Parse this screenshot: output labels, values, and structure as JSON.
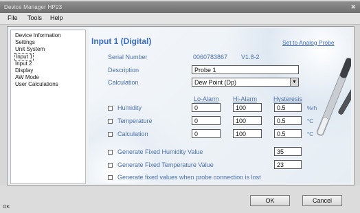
{
  "window": {
    "title": "Device Manager HP23",
    "close_glyph": "✕"
  },
  "menu": [
    "File",
    "Tools",
    "Help"
  ],
  "tree": [
    {
      "label": "Device Information",
      "selected": false
    },
    {
      "label": "Settings",
      "selected": false
    },
    {
      "label": "Unit System",
      "selected": false
    },
    {
      "label": "Input 1",
      "selected": true
    },
    {
      "label": "Input 2",
      "selected": false
    },
    {
      "label": "Display",
      "selected": false
    },
    {
      "label": "AW Mode",
      "selected": false
    },
    {
      "label": "User Calculations",
      "selected": false
    }
  ],
  "panel": {
    "heading": "Input 1 (Digital)",
    "link": "Set to Analog Probe",
    "serial_label": "Serial Number",
    "serial_value": "0060783867",
    "version": "V1.8-2",
    "description_label": "Description",
    "description_value": "Probe 1",
    "calculation_label": "Calculation",
    "calculation_value": "Dew Point (Dp)",
    "col_lo": "Lo-Alarm",
    "col_hi": "Hi-Alarm",
    "col_hyst": "Hysteresis",
    "rows": [
      {
        "label": "Humidity",
        "lo": "0",
        "hi": "100",
        "hyst": "0.5",
        "unit": "%rh"
      },
      {
        "label": "Temperature",
        "lo": "0",
        "hi": "100",
        "hyst": "0.5",
        "unit": "°C"
      },
      {
        "label": "Calculation",
        "lo": "0",
        "hi": "100",
        "hyst": "0.5",
        "unit": "°C"
      }
    ],
    "gen_humidity_label": "Generate Fixed Humidity Value",
    "gen_humidity_value": "35",
    "gen_temp_label": "Generate Fixed Temperature Value",
    "gen_temp_value": "23",
    "gen_lost_label": "Generate fixed values when probe connection is lost"
  },
  "buttons": {
    "ok": "OK",
    "cancel": "Cancel"
  },
  "status": "OK"
}
